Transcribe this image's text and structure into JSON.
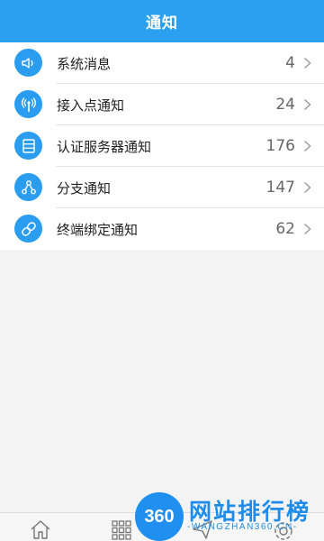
{
  "header": {
    "title": "通知"
  },
  "items": [
    {
      "label": "系统消息",
      "count": "4",
      "icon": "speaker-icon"
    },
    {
      "label": "接入点通知",
      "count": "24",
      "icon": "access-point-icon"
    },
    {
      "label": "认证服务器通知",
      "count": "176",
      "icon": "server-icon"
    },
    {
      "label": "分支通知",
      "count": "147",
      "icon": "branch-icon"
    },
    {
      "label": "终端绑定通知",
      "count": "62",
      "icon": "link-icon"
    }
  ],
  "bottom_nav": [
    {
      "icon": "home-icon"
    },
    {
      "icon": "grid-icon"
    },
    {
      "icon": "send-icon"
    },
    {
      "icon": "gear-icon"
    }
  ],
  "watermark": {
    "logo_text": "360",
    "title": "网站排行榜",
    "subtitle": "-WANGZHAN360.CN-"
  },
  "colors": {
    "accent": "#2ba0f0",
    "icon_bg": "#2a9df0"
  }
}
